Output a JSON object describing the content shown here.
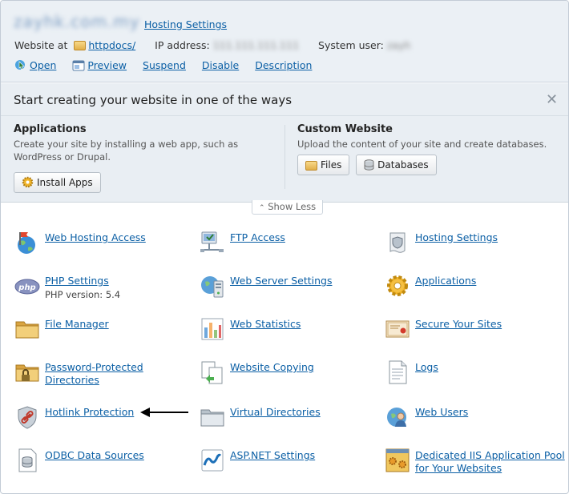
{
  "header": {
    "domain": "zayhk.com.my",
    "hosting_settings": "Hosting Settings",
    "website_at_label": "Website at",
    "website_at_value": "httpdocs/",
    "ip_label": "IP address:",
    "ip_value": "111.111.111.111",
    "system_user_label": "System user:",
    "system_user_value": "zayh",
    "actions": [
      "Open",
      "Preview",
      "Suspend",
      "Disable",
      "Description"
    ]
  },
  "promo": {
    "title": "Start creating your website in one of the ways",
    "applications": {
      "heading": "Applications",
      "description": "Create your site by installing a web app, such as WordPress or Drupal.",
      "button": "Install Apps"
    },
    "custom": {
      "heading": "Custom Website",
      "description": "Upload the content of your site and create databases.",
      "files_button": "Files",
      "databases_button": "Databases"
    },
    "show_less": "Show Less"
  },
  "tiles": [
    {
      "label": "Web Hosting Access",
      "icon": "globe-flag-icon"
    },
    {
      "label": "FTP Access",
      "icon": "ftp-network-icon"
    },
    {
      "label": "Hosting Settings",
      "icon": "scroll-shield-icon"
    },
    {
      "label": "PHP Settings",
      "sub": "PHP version: 5.4",
      "icon": "php-icon"
    },
    {
      "label": "Web Server Settings",
      "icon": "web-server-icon"
    },
    {
      "label": "Applications",
      "icon": "gear-icon"
    },
    {
      "label": "File Manager",
      "icon": "folder-icon"
    },
    {
      "label": "Web Statistics",
      "icon": "bar-chart-icon"
    },
    {
      "label": "Secure Your Sites",
      "icon": "certificate-icon"
    },
    {
      "label": "Password-Protected Directories",
      "icon": "locked-folder-icon"
    },
    {
      "label": "Website Copying",
      "icon": "copy-pages-icon"
    },
    {
      "label": "Logs",
      "icon": "log-document-icon"
    },
    {
      "label": "Hotlink Protection",
      "icon": "chain-shield-icon"
    },
    {
      "label": "Virtual Directories",
      "icon": "empty-folder-icon"
    },
    {
      "label": "Web Users",
      "icon": "user-globe-icon"
    },
    {
      "label": "ODBC Data Sources",
      "icon": "database-document-icon"
    },
    {
      "label": "ASP.NET Settings",
      "icon": "aspnet-icon"
    },
    {
      "label": "Dedicated IIS Application Pool for Your Websites",
      "icon": "iis-pool-icon"
    }
  ]
}
